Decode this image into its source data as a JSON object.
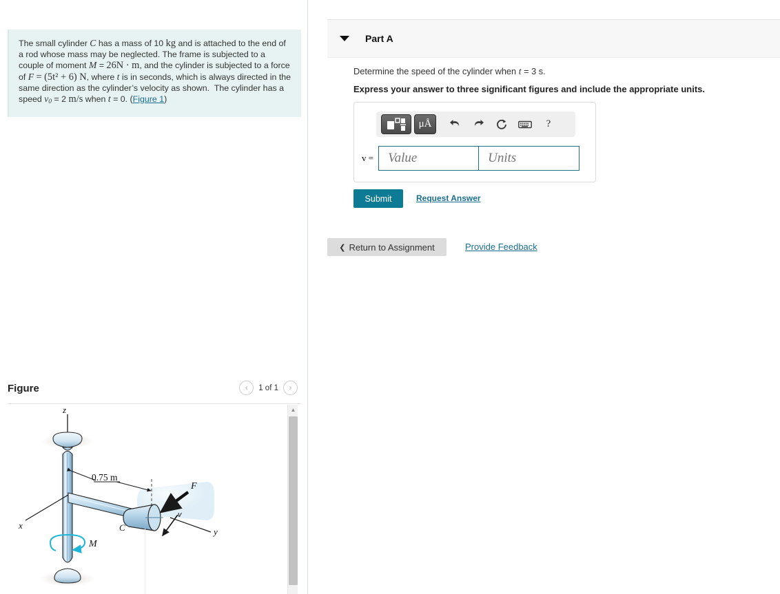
{
  "problem": {
    "text_plain": "The small cylinder C has a mass of 10 kg and is attached to the end of a rod whose mass may be neglected. The frame is subjected to a couple of moment M = 26 N·m, and the cylinder is subjected to a force of F = (5t^2 + 6) N, where t is in seconds, which is always directed in the same direction as the cylinder's velocity as shown. The cylinder has a speed v0 = 2 m/s when t = 0.",
    "figure_link_label": "Figure 1",
    "mass_value": "10",
    "mass_unit": "kg",
    "moment_symbol": "M",
    "moment_value": "26",
    "moment_unit": "N · m",
    "force_symbol": "F",
    "force_expr": "(5t² + 6)",
    "force_unit": "N",
    "initial_speed_symbol": "v0",
    "initial_speed_value": "2",
    "initial_speed_unit": "m/s",
    "initial_time": "0",
    "cylinder_label": "C"
  },
  "figure": {
    "title": "Figure",
    "pager_label": "1 of 1",
    "prev_arrow": "‹",
    "next_arrow": "›",
    "labels": {
      "z_axis": "z",
      "x_axis": "x",
      "y_axis": "y",
      "dimension": "0.75 m",
      "cylinder": "C",
      "force": "F",
      "velocity": "v",
      "moment": "M"
    },
    "colors": {
      "rod_light": "#dceaf5",
      "rod_mid": "#a9cde4",
      "rod_dark": "#5f93b8",
      "moment_arrow": "#1eb6d8",
      "outline": "#1a1a1a"
    }
  },
  "part_a": {
    "header_title": "Part A",
    "caret": "collapse-caret",
    "prompt_prefix": "Determine the speed of the cylinder when ",
    "prompt_var": "t",
    "prompt_suffix": " = 3 s.",
    "emphasis": "Express your answer to three significant figures and include the appropriate units."
  },
  "toolbar": {
    "template_button_name": "math-template",
    "units_button_label": "μÅ",
    "undo_label": "undo",
    "redo_label": "redo",
    "reset_label": "reset",
    "keyboard_label": "keyboard",
    "help_label": "?"
  },
  "answer": {
    "variable_label": "v =",
    "value_placeholder": "Value",
    "units_placeholder": "Units",
    "value_current": "",
    "units_current": ""
  },
  "actions": {
    "submit_label": "Submit",
    "request_answer_label": "Request Answer",
    "return_label": "Return to Assignment",
    "return_chevron": "❮",
    "provide_feedback_label": "Provide Feedback"
  },
  "colors": {
    "accent_teal": "#0e7b94",
    "link_blue": "#1a6e8e",
    "panel_mint": "#e7f3f3",
    "header_gray": "#f7f7f7",
    "input_border": "#1d7186"
  }
}
